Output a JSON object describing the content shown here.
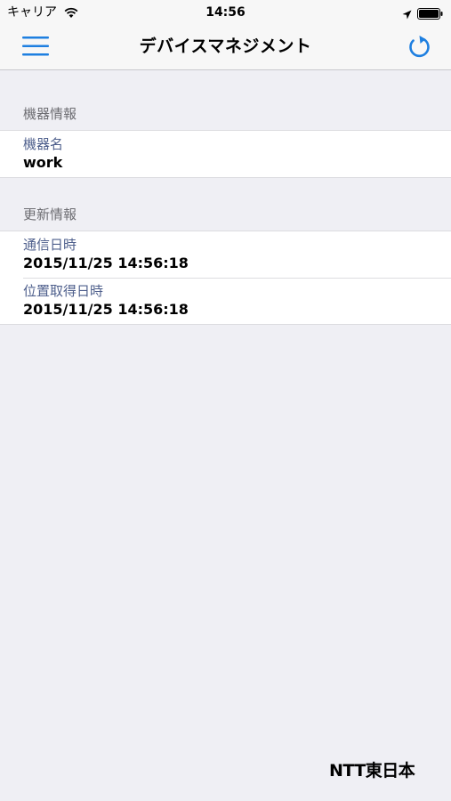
{
  "status_bar": {
    "carrier": "キャリア",
    "time": "14:56"
  },
  "nav": {
    "title": "デバイスマネジメント",
    "menu_icon": "hamburger-icon",
    "refresh_icon": "refresh-icon",
    "accent_color": "#1e7fe0"
  },
  "sections": {
    "device_info": {
      "header": "機器情報",
      "rows": [
        {
          "label": "機器名",
          "value": "work"
        }
      ]
    },
    "update_info": {
      "header": "更新情報",
      "rows": [
        {
          "label": "通信日時",
          "value": "2015/11/25 14:56:18"
        },
        {
          "label": "位置取得日時",
          "value": "2015/11/25 14:56:18"
        }
      ]
    }
  },
  "footer": {
    "logo": "NTT東日本"
  }
}
